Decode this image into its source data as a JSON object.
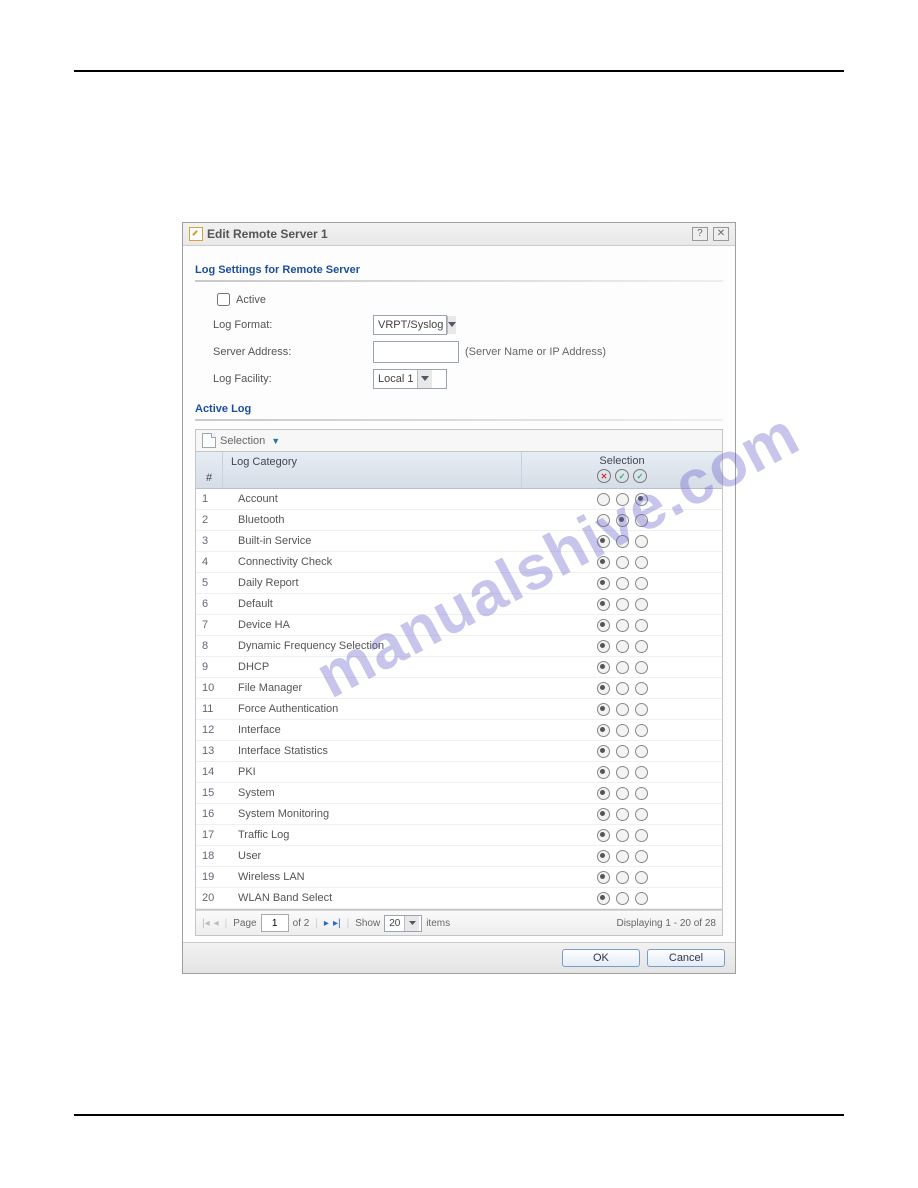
{
  "dialog": {
    "title": "Edit Remote Server 1",
    "help_icon": "?",
    "close_icon": "✕"
  },
  "section1": {
    "title": "Log Settings for Remote Server",
    "active_label": "Active",
    "log_format_label": "Log Format:",
    "log_format_value": "VRPT/Syslog",
    "server_address_label": "Server Address:",
    "server_address_value": "",
    "server_address_hint": "(Server Name or IP Address)",
    "log_facility_label": "Log Facility:",
    "log_facility_value": "Local 1"
  },
  "section2": {
    "title": "Active Log",
    "selection_label": "Selection"
  },
  "grid": {
    "col_num": "#",
    "col_category": "Log Category",
    "col_selection": "Selection",
    "rows": [
      {
        "n": "1",
        "cat": "Account",
        "sel": 2
      },
      {
        "n": "2",
        "cat": "Bluetooth",
        "sel": 1
      },
      {
        "n": "3",
        "cat": "Built-in Service",
        "sel": 0
      },
      {
        "n": "4",
        "cat": "Connectivity Check",
        "sel": 0
      },
      {
        "n": "5",
        "cat": "Daily Report",
        "sel": 0
      },
      {
        "n": "6",
        "cat": "Default",
        "sel": 0
      },
      {
        "n": "7",
        "cat": "Device HA",
        "sel": 0
      },
      {
        "n": "8",
        "cat": "Dynamic Frequency Selection",
        "sel": 0
      },
      {
        "n": "9",
        "cat": "DHCP",
        "sel": 0
      },
      {
        "n": "10",
        "cat": "File Manager",
        "sel": 0
      },
      {
        "n": "11",
        "cat": "Force Authentication",
        "sel": 0
      },
      {
        "n": "12",
        "cat": "Interface",
        "sel": 0
      },
      {
        "n": "13",
        "cat": "Interface Statistics",
        "sel": 0
      },
      {
        "n": "14",
        "cat": "PKI",
        "sel": 0
      },
      {
        "n": "15",
        "cat": "System",
        "sel": 0
      },
      {
        "n": "16",
        "cat": "System Monitoring",
        "sel": 0
      },
      {
        "n": "17",
        "cat": "Traffic Log",
        "sel": 0
      },
      {
        "n": "18",
        "cat": "User",
        "sel": 0
      },
      {
        "n": "19",
        "cat": "Wireless LAN",
        "sel": 0
      },
      {
        "n": "20",
        "cat": "WLAN Band Select",
        "sel": 0
      }
    ]
  },
  "pager": {
    "page_label": "Page",
    "page_value": "1",
    "of_label": "of 2",
    "show_label": "Show",
    "show_value": "20",
    "items_label": "items",
    "display_text": "Displaying 1 - 20 of 28"
  },
  "footer": {
    "ok": "OK",
    "cancel": "Cancel"
  },
  "watermark": "manualshive.com"
}
